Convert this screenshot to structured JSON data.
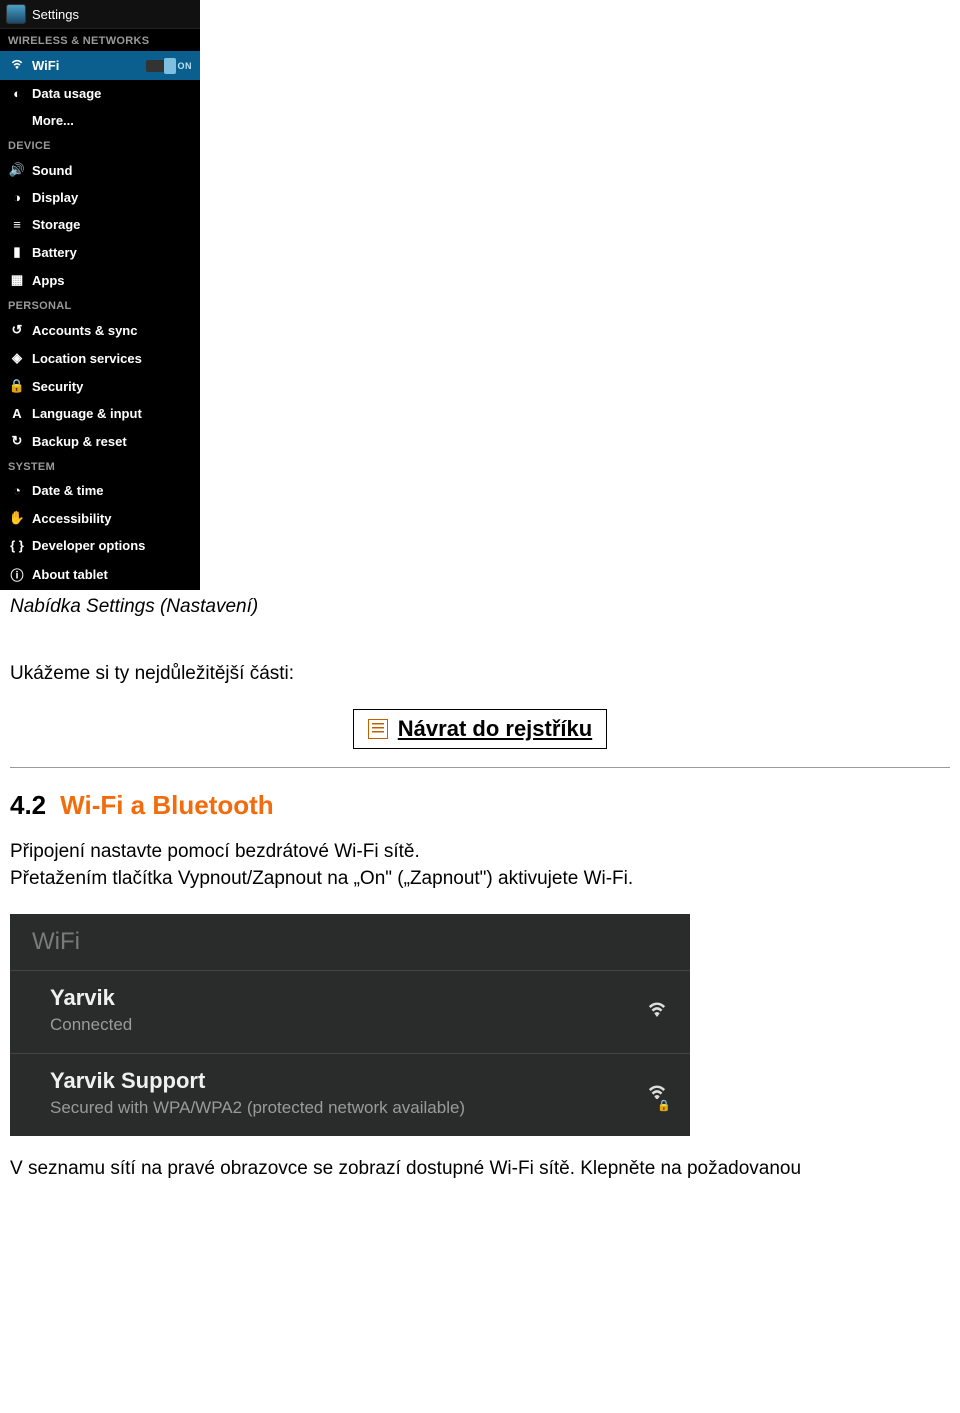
{
  "settings": {
    "title": "Settings",
    "sections": {
      "wireless": "WIRELESS & NETWORKS",
      "device": "DEVICE",
      "personal": "PERSONAL",
      "system": "SYSTEM"
    },
    "items": {
      "wifi": "WiFi",
      "wifi_on": "ON",
      "data_usage": "Data usage",
      "more": "More...",
      "sound": "Sound",
      "display": "Display",
      "storage": "Storage",
      "battery": "Battery",
      "apps": "Apps",
      "accounts": "Accounts & sync",
      "location": "Location services",
      "security": "Security",
      "language": "Language & input",
      "backup": "Backup & reset",
      "datetime": "Date & time",
      "accessibility": "Accessibility",
      "developer": "Developer options",
      "about": "About tablet"
    }
  },
  "document": {
    "caption": "Nabídka Settings (Nastavení)",
    "intro": "Ukážeme si ty nejdůležitější části:",
    "return_link": "Návrat do rejstříku",
    "section_number": "4.2",
    "section_title": "Wi-Fi a Bluetooth",
    "para1": "Připojení nastavte pomocí bezdrátové Wi-Fi sítě.\nPřetažením tlačítka Vypnout/Zapnout na „On\" („Zapnout\") aktivujete Wi-Fi.",
    "final": "V seznamu sítí na pravé obrazovce se zobrazí dostupné Wi-Fi sítě. Klepněte na požadovanou"
  },
  "wifi_list": {
    "title": "WiFi",
    "networks": [
      {
        "name": "Yarvik",
        "status": "Connected",
        "secured": false
      },
      {
        "name": "Yarvik Support",
        "status": "Secured with WPA/WPA2 (protected network available)",
        "secured": true
      }
    ]
  }
}
